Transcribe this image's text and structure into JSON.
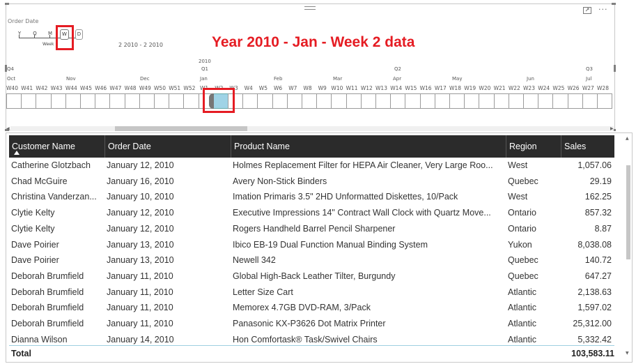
{
  "timeline": {
    "title": "Order Date",
    "granularity": {
      "levels": [
        "Y",
        "Q",
        "M",
        "W",
        "D"
      ],
      "selected": "W",
      "selected_sub": "Week"
    },
    "range_label": "2 2010 - 2 2010",
    "overlay_title": "Year 2010 - Jan - Week 2 data",
    "years": [
      {
        "label": "2010"
      }
    ],
    "quarters": [
      "Q4",
      "Q1",
      "Q2",
      "Q3"
    ],
    "months": [
      "Oct",
      "Nov",
      "Dec",
      "Jan",
      "Feb",
      "Mar",
      "Apr",
      "May",
      "Jun",
      "Jul"
    ],
    "weeks": [
      "W40",
      "W41",
      "W42",
      "W43",
      "W44",
      "W45",
      "W46",
      "W47",
      "W48",
      "W49",
      "W50",
      "W51",
      "W52",
      "W1",
      "W2",
      "W3",
      "W4",
      "W5",
      "W6",
      "W7",
      "W8",
      "W9",
      "W10",
      "W11",
      "W12",
      "W13",
      "W14",
      "W15",
      "W16",
      "W17",
      "W18",
      "W19",
      "W20",
      "W21",
      "W22",
      "W23",
      "W24",
      "W25",
      "W26",
      "W27",
      "W28"
    ],
    "selected_week": "W2"
  },
  "table": {
    "columns": [
      {
        "key": "customer",
        "label": "Customer Name"
      },
      {
        "key": "date",
        "label": "Order Date"
      },
      {
        "key": "product",
        "label": "Product Name"
      },
      {
        "key": "region",
        "label": "Region"
      },
      {
        "key": "sales",
        "label": "Sales"
      }
    ],
    "rows": [
      {
        "customer": "Catherine Glotzbach",
        "date": "January 12, 2010",
        "product": "Holmes Replacement Filter for HEPA Air Cleaner, Very Large Roo...",
        "region": "West",
        "sales": "1,057.06"
      },
      {
        "customer": "Chad McGuire",
        "date": "January 16, 2010",
        "product": "Avery Non-Stick Binders",
        "region": "Quebec",
        "sales": "29.19"
      },
      {
        "customer": "Christina Vanderzan...",
        "date": "January 10, 2010",
        "product": "Imation Primaris 3.5\" 2HD Unformatted Diskettes, 10/Pack",
        "region": "West",
        "sales": "162.25"
      },
      {
        "customer": "Clytie Kelty",
        "date": "January 12, 2010",
        "product": "Executive Impressions 14\" Contract Wall Clock with Quartz Move...",
        "region": "Ontario",
        "sales": "857.32"
      },
      {
        "customer": "Clytie Kelty",
        "date": "January 12, 2010",
        "product": "Rogers Handheld Barrel Pencil Sharpener",
        "region": "Ontario",
        "sales": "8.87"
      },
      {
        "customer": "Dave Poirier",
        "date": "January 13, 2010",
        "product": "Ibico EB-19 Dual Function Manual Binding System",
        "region": "Yukon",
        "sales": "8,038.08"
      },
      {
        "customer": "Dave Poirier",
        "date": "January 13, 2010",
        "product": "Newell 342",
        "region": "Quebec",
        "sales": "140.72"
      },
      {
        "customer": "Deborah Brumfield",
        "date": "January 11, 2010",
        "product": "Global High-Back Leather Tilter, Burgundy",
        "region": "Quebec",
        "sales": "647.27"
      },
      {
        "customer": "Deborah Brumfield",
        "date": "January 11, 2010",
        "product": "Letter Size Cart",
        "region": "Atlantic",
        "sales": "2,138.63"
      },
      {
        "customer": "Deborah Brumfield",
        "date": "January 11, 2010",
        "product": "Memorex 4.7GB DVD-RAM, 3/Pack",
        "region": "Atlantic",
        "sales": "1,597.02"
      },
      {
        "customer": "Deborah Brumfield",
        "date": "January 11, 2010",
        "product": "Panasonic KX-P3626 Dot Matrix Printer",
        "region": "Atlantic",
        "sales": "25,312.00"
      },
      {
        "customer": "Dianna Wilson",
        "date": "January 14, 2010",
        "product": "Hon Comfortask® Task/Swivel Chairs",
        "region": "Atlantic",
        "sales": "5,332.42"
      }
    ],
    "total_label": "Total",
    "total_value": "103,583.11"
  },
  "colors": {
    "accent_red": "#e51c23",
    "header_bg": "#2b2b2b",
    "selected_week": "#9fd3e6"
  },
  "icons": {
    "focus": "focus-mode-icon",
    "more": "more-options-icon",
    "drag": "drag-handle-icon",
    "sort": "sort-ascending-icon"
  }
}
